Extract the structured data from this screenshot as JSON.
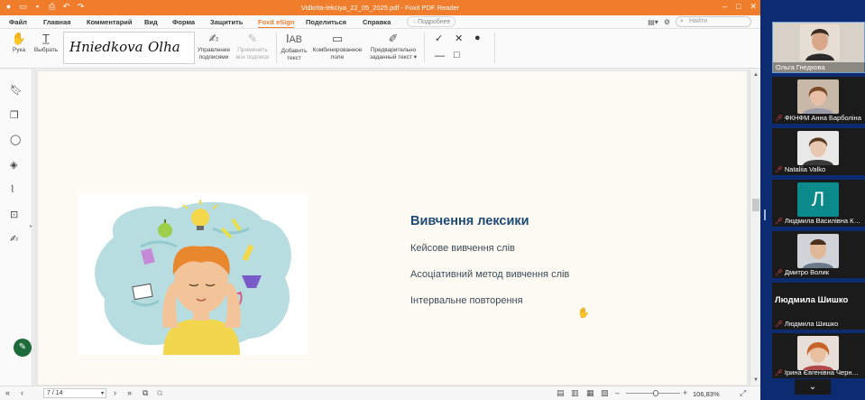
{
  "window": {
    "title": "Vidkrita-lekciya_22_05_2025.pdf - Foxit PDF Reader",
    "brand_color": "#f07d2b"
  },
  "menu": {
    "tabs": [
      "Файл",
      "Главная",
      "Комментарий",
      "Вид",
      "Форма",
      "Защитить",
      "Foxit eSign",
      "Поделиться",
      "Справка"
    ],
    "active_tab": "Foxit eSign",
    "hint_label": "Подробнее",
    "search_placeholder": "Найти"
  },
  "ribbon": {
    "hand_label": "Рука",
    "select_label": "Выбрать",
    "signatures": [
      "Hniedkova",
      "Olha"
    ],
    "manage_signatures": "Управление подписями",
    "apply_all_signatures": "Применить все подписи",
    "add_text": "Добавить текст",
    "combined_field": "Комбинированное поле",
    "predefined_text": "Предварительно заданный текст"
  },
  "slide": {
    "title": "Вивчення лексики",
    "items": [
      "Кейсове вивчення слів",
      "Асоціативний метод вивчення слів",
      "Інтервальне повторення"
    ],
    "title_color": "#1e4a76"
  },
  "status": {
    "page_display": "7 / 14",
    "zoom_display": "106,83%",
    "zoom_level": 0.55
  },
  "participants": [
    {
      "name": "Ольга Гнедкова",
      "muted": false,
      "active": true
    },
    {
      "name": "ФКНФМ Анна Барболіна",
      "muted": true
    },
    {
      "name": "Nataliia Valko",
      "muted": true
    },
    {
      "name": "Людмила Василівна К…",
      "muted": true,
      "initial": "Л"
    },
    {
      "name": "Дмитро Волик",
      "muted": true
    },
    {
      "name": "Людмила Шишко",
      "muted": true,
      "big_name": "Людмила  Шишко"
    },
    {
      "name": "Ірина Євгенівна Черн…",
      "muted": true
    }
  ]
}
